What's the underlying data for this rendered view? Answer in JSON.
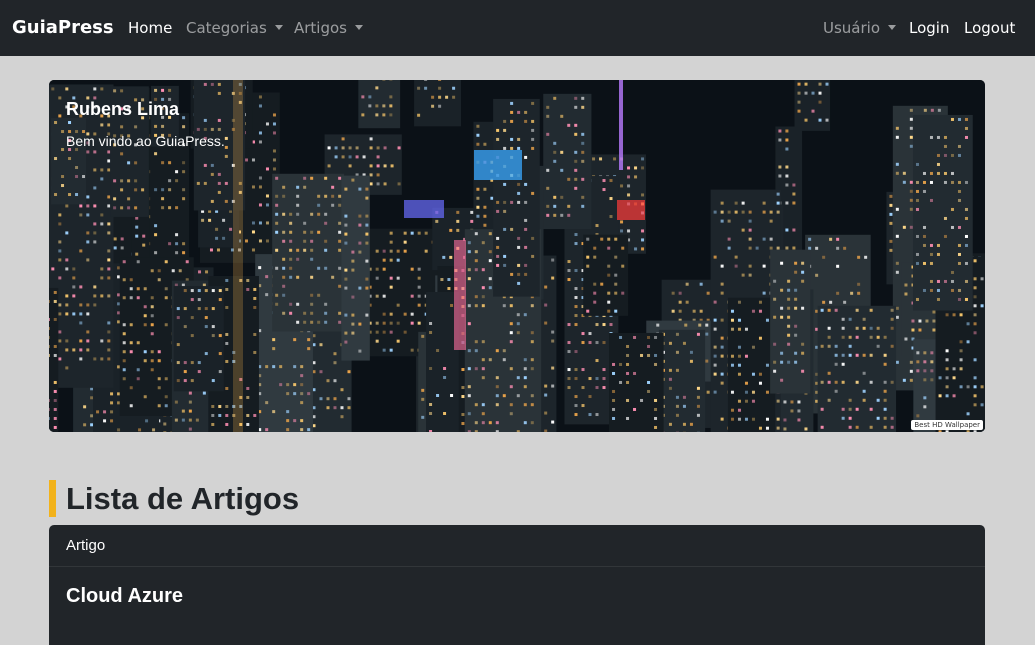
{
  "navbar": {
    "brand": "GuiaPress",
    "home": "Home",
    "categorias": "Categorias",
    "artigos": "Artigos",
    "usuario": "Usuário",
    "login": "Login",
    "logout": "Logout"
  },
  "hero": {
    "title": "Rubens Lima",
    "text": "Bem vindo ao GuiaPress.",
    "watermark": "Best HD Wallpaper"
  },
  "articles": {
    "heading": "Lista de Artigos",
    "card_header": "Artigo",
    "items": [
      "Cloud Azure"
    ]
  },
  "colors": {
    "navbar_bg": "#212529",
    "page_bg": "#d3d3d3",
    "accent": "#f2b21b"
  }
}
